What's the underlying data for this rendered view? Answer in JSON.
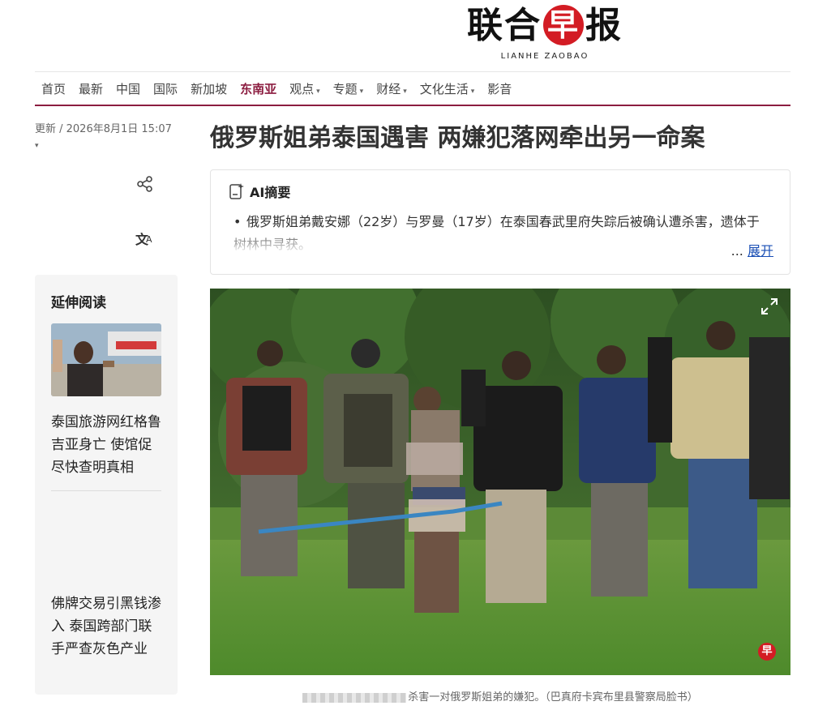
{
  "logo": {
    "cn_left": "联合",
    "cn_circle": "早",
    "cn_right": "报",
    "en": "LIANHE ZAOBAO"
  },
  "nav": {
    "items": [
      {
        "label": "首页"
      },
      {
        "label": "最新"
      },
      {
        "label": "中国"
      },
      {
        "label": "国际"
      },
      {
        "label": "新加坡"
      },
      {
        "label": "东南亚"
      },
      {
        "label": "观点"
      },
      {
        "label": "专题"
      },
      {
        "label": "财经"
      },
      {
        "label": "文化生活"
      },
      {
        "label": "影音"
      }
    ],
    "active": "东南亚",
    "caret": "▾"
  },
  "meta": {
    "updated": "更新 / 2026年8月1日 15:07",
    "caret": "▾"
  },
  "actions": {
    "share_icon": "share-icon",
    "translate_icon": "translate-icon",
    "translate_glyph": "文"
  },
  "related": {
    "title": "延伸阅读",
    "items": [
      {
        "text": "泰国旅游网红格鲁吉亚身亡 使馆促尽快查明真相"
      },
      {
        "text": "佛牌交易引黑钱渗入 泰国跨部门联手严查灰色产业"
      }
    ]
  },
  "article": {
    "headline": "俄罗斯姐弟泰国遇害 两嫌犯落网牵出另一命案",
    "ai_summary": {
      "title": "AI摘要",
      "bullet": "•",
      "text": "俄罗斯姐弟戴安娜（22岁）与罗曼（17岁）在泰国春武里府失踪后被确认遭杀害，遗体于树林中寻获。",
      "ellipsis": "...",
      "expand": "展开"
    },
    "photo": {
      "watermark": "早"
    },
    "caption": "杀害一对俄罗斯姐弟的嫌犯。（巴真府卡宾布里县警察局脸书）"
  },
  "colors": {
    "brand": "#8c1d40",
    "logo_red": "#d31c24",
    "link": "#1a4fb5"
  }
}
